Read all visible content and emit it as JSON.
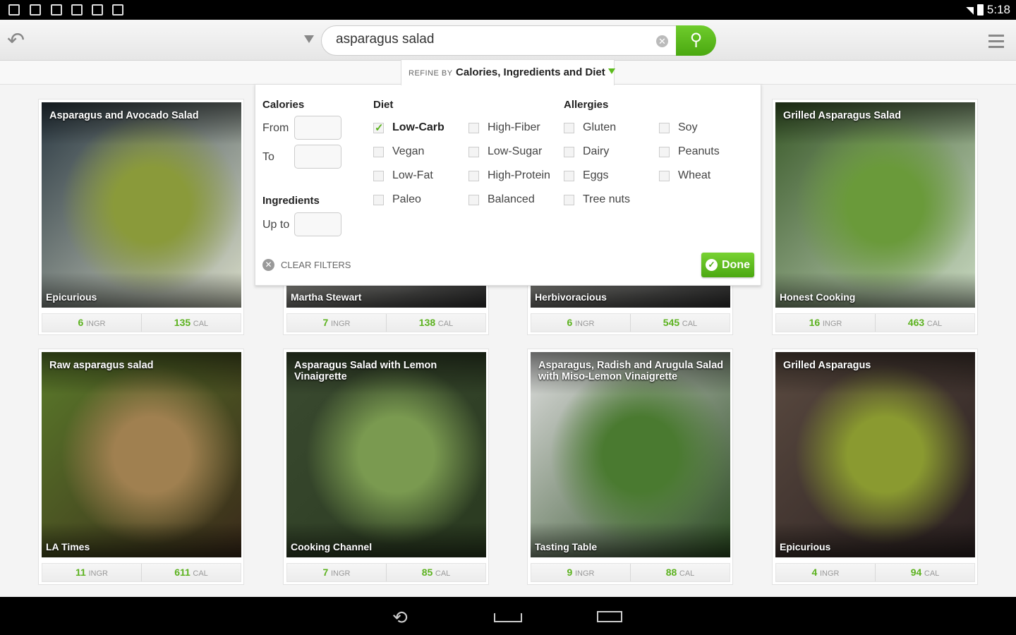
{
  "status_bar": {
    "time": "5:18",
    "icons": [
      "download-icon",
      "gallery-icon",
      "gmail-icon",
      "calendar-icon",
      "calendar-icon",
      "play-store-icon"
    ]
  },
  "toolbar": {
    "search_value": "asparagus salad",
    "search_placeholder": "Search"
  },
  "refine": {
    "prefix": "REFINE BY",
    "title": "Calories, Ingredients and Diet"
  },
  "filters": {
    "calories_heading": "Calories",
    "from_label": "From",
    "to_label": "To",
    "ingredients_heading": "Ingredients",
    "upto_label": "Up to",
    "diet_heading": "Diet",
    "allergies_heading": "Allergies",
    "diet": [
      {
        "label": "Low-Carb",
        "checked": true
      },
      {
        "label": "Vegan",
        "checked": false
      },
      {
        "label": "Low-Fat",
        "checked": false
      },
      {
        "label": "Paleo",
        "checked": false
      },
      {
        "label": "High-Fiber",
        "checked": false
      },
      {
        "label": "Low-Sugar",
        "checked": false
      },
      {
        "label": "High-Protein",
        "checked": false
      },
      {
        "label": "Balanced",
        "checked": false
      }
    ],
    "allergies": [
      {
        "label": "Gluten",
        "checked": false
      },
      {
        "label": "Dairy",
        "checked": false
      },
      {
        "label": "Eggs",
        "checked": false
      },
      {
        "label": "Tree nuts",
        "checked": false
      },
      {
        "label": "Soy",
        "checked": false
      },
      {
        "label": "Peanuts",
        "checked": false
      },
      {
        "label": "Wheat",
        "checked": false
      }
    ],
    "clear_label": "CLEAR FILTERS",
    "done_label": "Done"
  },
  "stat_units": {
    "ingr": "INGR",
    "cal": "CAL"
  },
  "recipes": [
    {
      "title": "Asparagus and Avocado Salad",
      "source": "Epicurious",
      "ingr": "6",
      "cal": "135",
      "colors": [
        "#2c3a44",
        "#8a9a3a",
        "#d8dcc8"
      ]
    },
    {
      "title": "",
      "source": "Martha Stewart",
      "ingr": "7",
      "cal": "138",
      "colors": [
        "#c8c8c0",
        "#888",
        "#333"
      ]
    },
    {
      "title": "",
      "source": "Herbivoracious",
      "ingr": "6",
      "cal": "545",
      "colors": [
        "#c0c0b8",
        "#777",
        "#333"
      ]
    },
    {
      "title": "Grilled Asparagus Salad",
      "source": "Honest Cooking",
      "ingr": "16",
      "cal": "463",
      "colors": [
        "#3a5a2a",
        "#6a9a3a",
        "#c8d8c0"
      ]
    },
    {
      "title": "Raw asparagus salad",
      "source": "LA Times",
      "ingr": "11",
      "cal": "611",
      "colors": [
        "#5a7a2a",
        "#a08050",
        "#3a2a1a"
      ]
    },
    {
      "title": "Asparagus Salad with Lemon Vinaigrette",
      "source": "Cooking Channel",
      "ingr": "7",
      "cal": "85",
      "colors": [
        "#3a4a30",
        "#7a9a50",
        "#2a3a20"
      ]
    },
    {
      "title": "Asparagus, Radish and Arugula Salad with Miso-Lemon Vinaigrette",
      "source": "Tasting Table",
      "ingr": "9",
      "cal": "88",
      "colors": [
        "#ddd",
        "#4a7a30",
        "#2a4a20"
      ]
    },
    {
      "title": "Grilled Asparagus",
      "source": "Epicurious",
      "ingr": "4",
      "cal": "94",
      "colors": [
        "#5a4a40",
        "#8a9a30",
        "#2a2020"
      ]
    }
  ],
  "colors": {
    "accent": "#5cb21f"
  }
}
